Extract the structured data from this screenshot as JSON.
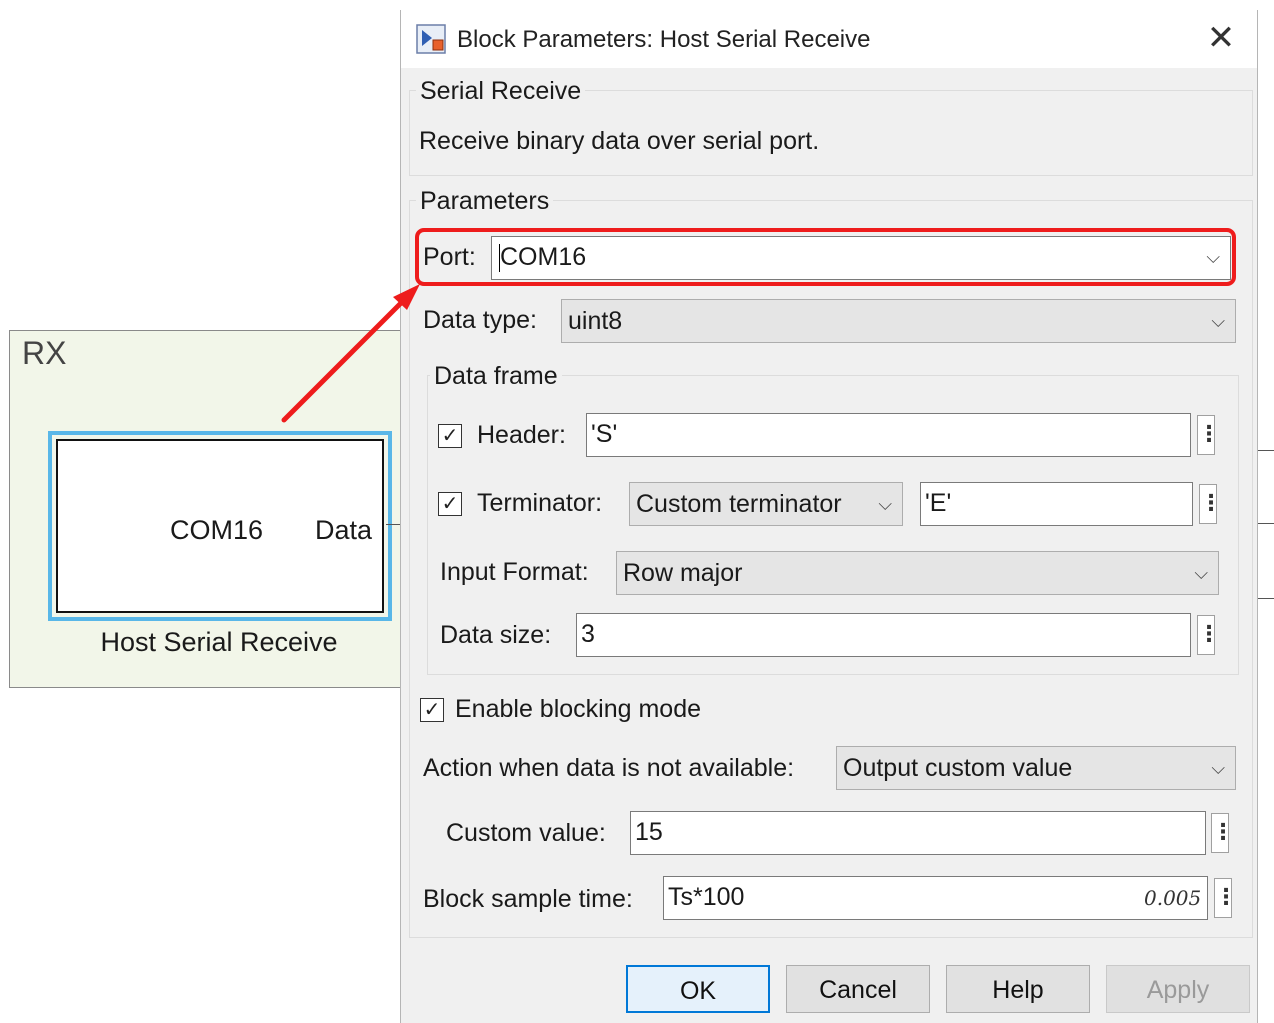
{
  "canvas": {
    "subsystem_title": "RX",
    "block": {
      "parameter_text": "COM16",
      "output_port": "Data",
      "name": "Host Serial Receive"
    }
  },
  "dialog": {
    "title": "Block Parameters: Host Serial Receive",
    "description_group": {
      "label": "Serial Receive",
      "text": "Receive binary data over serial port."
    },
    "parameters_group": {
      "label": "Parameters",
      "port": {
        "label": "Port:",
        "value": "COM16"
      },
      "data_type": {
        "label": "Data type:",
        "value": "uint8"
      },
      "data_frame": {
        "label": "Data frame",
        "header": {
          "checked": true,
          "label": "Header:",
          "value": "'S'"
        },
        "terminator": {
          "checked": true,
          "label": "Terminator:",
          "type_value": "Custom terminator",
          "value": "'E'"
        },
        "input_format": {
          "label": "Input Format:",
          "value": "Row major"
        },
        "data_size": {
          "label": "Data size:",
          "value": "3"
        }
      },
      "enable_blocking": {
        "checked": true,
        "label": "Enable blocking mode"
      },
      "action": {
        "label": "Action when data is not available:",
        "value": "Output custom value"
      },
      "custom_value": {
        "label": "Custom value:",
        "value": "15"
      },
      "sample_time": {
        "label": "Block sample time:",
        "value": "Ts*100",
        "evaluated": "0.005"
      }
    },
    "buttons": {
      "ok": "OK",
      "cancel": "Cancel",
      "help": "Help",
      "apply": "Apply"
    },
    "check_glyph": "✓",
    "more_glyph": "⋮",
    "chevron_glyph": "⌵",
    "close_glyph": "✕"
  },
  "annotation": {
    "color": "#ee1c1c"
  }
}
